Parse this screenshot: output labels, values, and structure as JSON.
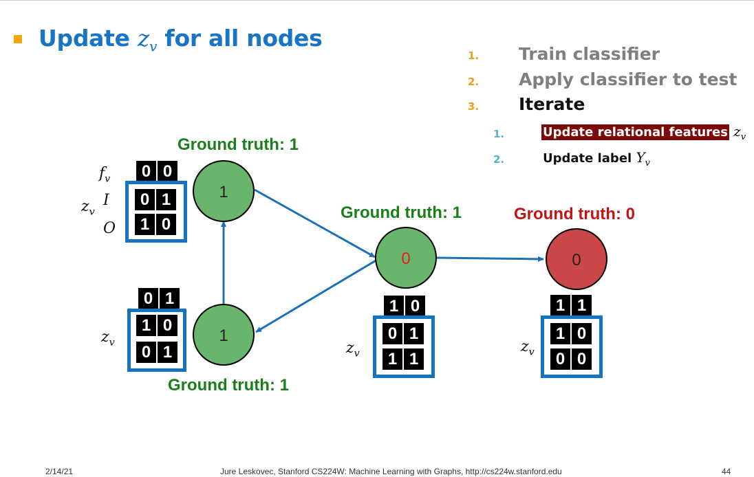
{
  "slide": {
    "headline_prefix": "Update ",
    "headline_var": "z",
    "headline_sub": "v",
    "headline_suffix": " for all nodes"
  },
  "steps": [
    {
      "num": "1.",
      "text": "Train classifier"
    },
    {
      "num": "2.",
      "text": "Apply classifier to test"
    },
    {
      "num": "3.",
      "text": "Iterate"
    }
  ],
  "substeps": [
    {
      "num": "1.",
      "text": "Update relational features",
      "var": "z",
      "var_sub": "v"
    },
    {
      "num": "2.",
      "text": "Update label ",
      "var": "Y",
      "var_sub": "v"
    }
  ],
  "ground_truth": {
    "top_left": "Ground truth: 1",
    "bottom_left": "Ground truth: 1",
    "middle": "Ground truth: 1",
    "right": "Ground truth: 0"
  },
  "nodes": {
    "top_left": "1",
    "bottom_left": "1",
    "middle": "0",
    "right": "0"
  },
  "colors": {
    "green_node": "#6ab56c",
    "red_node": "#cc4848",
    "edge": "#1d6fb8",
    "frame": "#1472c1",
    "middle_label": "#e02020"
  },
  "matrices": {
    "top_left": {
      "f": [
        "0",
        "0"
      ],
      "z1": [
        "0",
        "1"
      ],
      "z2": [
        "1",
        "0"
      ]
    },
    "bottom_left": {
      "f": [
        "0",
        "1"
      ],
      "z1": [
        "1",
        "0"
      ],
      "z2": [
        "0",
        "1"
      ]
    },
    "middle": {
      "f": [
        "1",
        "0"
      ],
      "z1": [
        "0",
        "1"
      ],
      "z2": [
        "1",
        "1"
      ]
    },
    "right": {
      "f": [
        "1",
        "1"
      ],
      "z1": [
        "1",
        "0"
      ],
      "z2": [
        "0",
        "0"
      ]
    }
  },
  "labels": {
    "f": "f",
    "f_sub": "v",
    "z": "z",
    "z_sub": "v",
    "I": "I",
    "O": "O"
  },
  "footer": {
    "date": "2/14/21",
    "course": "Jure Leskovec, Stanford CS224W: Machine Learning with Graphs, http://cs224w.stanford.edu",
    "page": "44"
  }
}
